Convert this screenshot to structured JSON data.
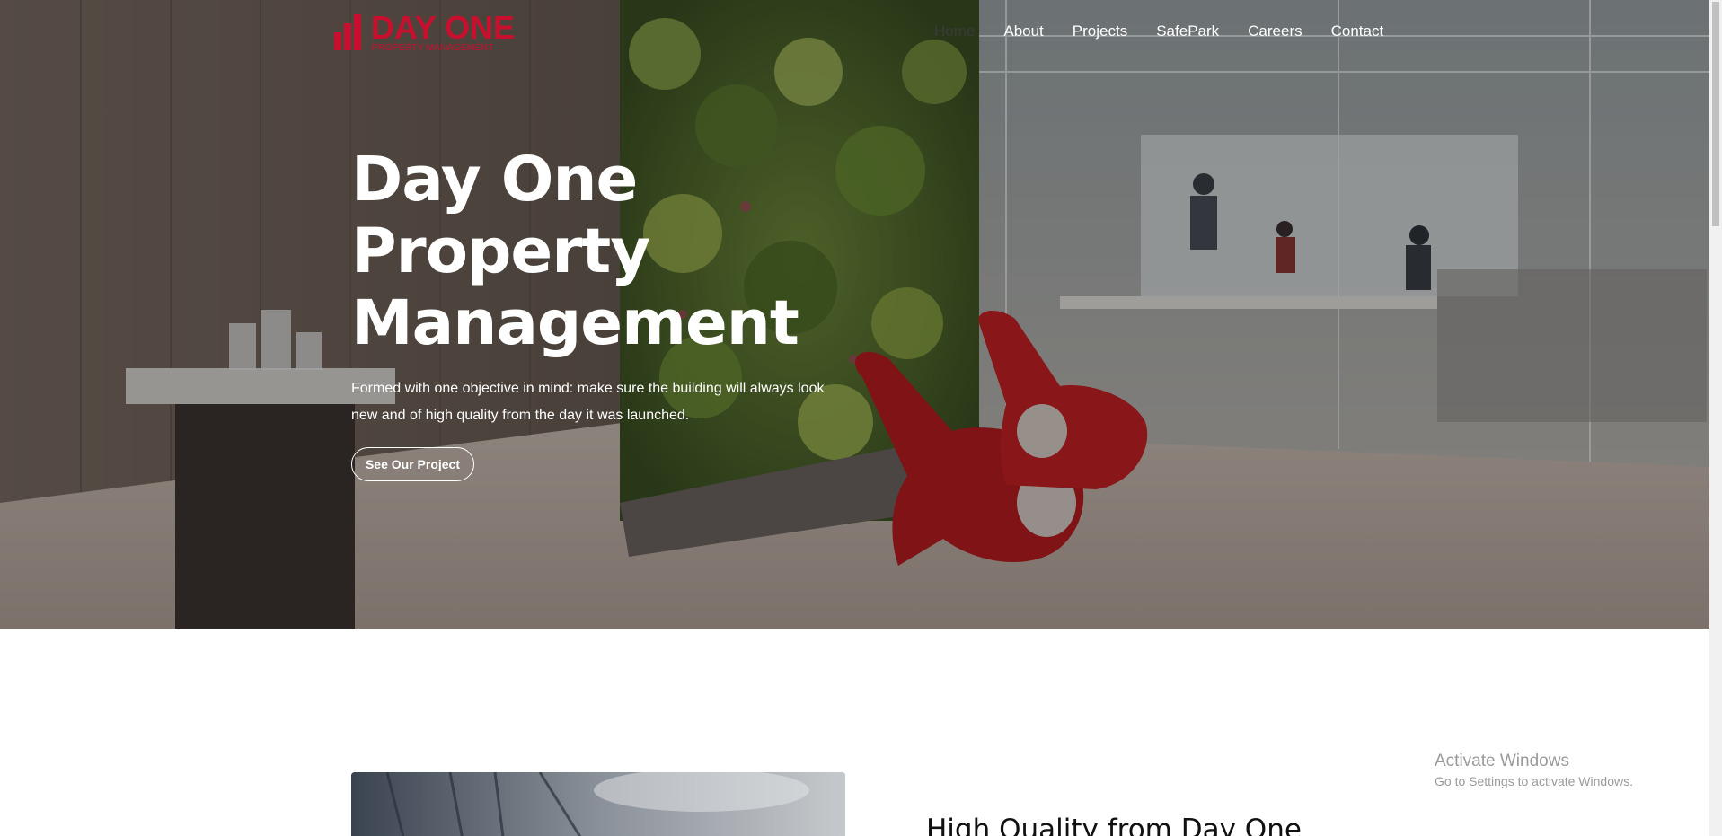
{
  "logo": {
    "title": "DAY ONE",
    "subtitle": "PROPERTY MANAGEMENT"
  },
  "nav": {
    "items": [
      {
        "label": "Home"
      },
      {
        "label": "About"
      },
      {
        "label": "Projects"
      },
      {
        "label": "SafePark"
      },
      {
        "label": "Careers"
      },
      {
        "label": "Contact"
      }
    ]
  },
  "hero": {
    "title_lines": [
      "Day One",
      "Property",
      "Management"
    ],
    "description": "Formed with one objective in mind: make sure the building will always look new and of high quality from the day it was launched.",
    "button_label": "See Our Project"
  },
  "section": {
    "title": "High Quality from Day One"
  },
  "watermark": {
    "title": "Activate Windows",
    "subtitle": "Go to Settings to activate Windows."
  },
  "colors": {
    "brand": "#c8102e",
    "hero_text": "#ffffff"
  }
}
